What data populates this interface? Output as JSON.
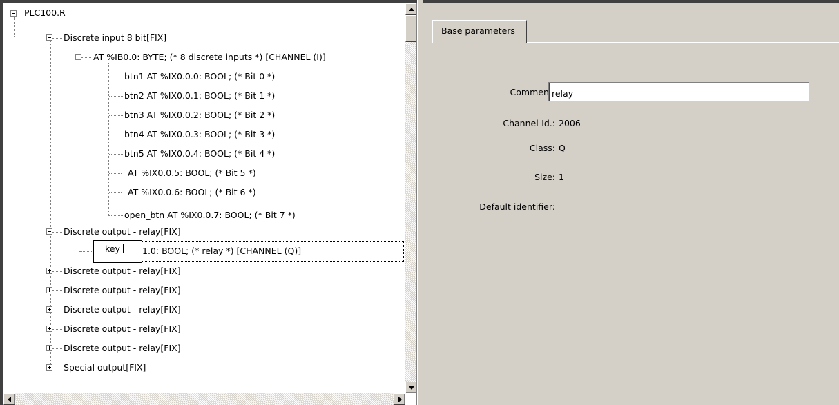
{
  "tree": {
    "root": "PLC100.R",
    "nodes": [
      {
        "label": "Discrete input 8 bit[FIX]"
      },
      {
        "label": "AT %IB0.0: BYTE; (* 8 discrete inputs *) [CHANNEL (I)]"
      },
      {
        "label": "btn1 AT %IX0.0.0: BOOL; (* Bit 0 *)"
      },
      {
        "label": "btn2 AT %IX0.0.1: BOOL; (* Bit 1 *)"
      },
      {
        "label": "btn3 AT %IX0.0.2: BOOL; (* Bit 2 *)"
      },
      {
        "label": "btn4 AT %IX0.0.3: BOOL; (* Bit 3 *)"
      },
      {
        "label": "btn5 AT %IX0.0.4: BOOL; (* Bit 4 *)"
      },
      {
        "label": "AT %IX0.0.5: BOOL; (* Bit 5 *)"
      },
      {
        "label": "AT %IX0.0.6: BOOL; (* Bit 6 *)"
      },
      {
        "label": "open_btn AT %IX0.0.7: BOOL; (* Bit 7 *)"
      },
      {
        "label": "Discrete output - relay[FIX]"
      },
      {
        "label": "1.0: BOOL; (* relay *) [CHANNEL (Q)]"
      },
      {
        "label": "Discrete output - relay[FIX]"
      },
      {
        "label": "Discrete output - relay[FIX]"
      },
      {
        "label": "Discrete output - relay[FIX]"
      },
      {
        "label": "Discrete output - relay[FIX]"
      },
      {
        "label": "Discrete output - relay[FIX]"
      },
      {
        "label": "Special output[FIX]"
      }
    ],
    "edit_value": "key"
  },
  "tabs": {
    "base": "Base parameters"
  },
  "params": {
    "comment_label": "Comment:",
    "comment_value": "relay",
    "channel_label": "Channel-Id.:",
    "channel_value": "2006",
    "class_label": "Class:",
    "class_value": "Q",
    "size_label": "Size:",
    "size_value": "1",
    "default_label": "Default identifier:"
  }
}
